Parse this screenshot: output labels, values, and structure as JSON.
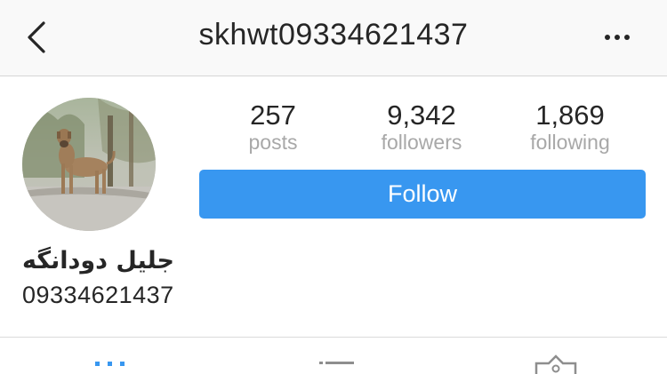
{
  "header": {
    "username": "skhwt09334621437",
    "back_icon": "chevron-left-icon",
    "more_icon": "more-horizontal-icon"
  },
  "profile": {
    "avatar_description_icon": "profile-photo",
    "stats": [
      {
        "value": "257",
        "label": "posts"
      },
      {
        "value": "9,342",
        "label": "followers"
      },
      {
        "value": "1,869",
        "label": "following"
      }
    ],
    "follow_label": "Follow",
    "full_name": "جلیل دودانگه",
    "bio": "09334621437"
  },
  "tabs": [
    {
      "icon": "grid-icon",
      "active": true
    },
    {
      "icon": "list-icon",
      "active": false
    },
    {
      "icon": "tagged-icon",
      "active": false
    }
  ],
  "colors": {
    "accent": "#3897f0",
    "nav_bg": "#f9f9f9",
    "muted_text": "#a8a8a8"
  }
}
